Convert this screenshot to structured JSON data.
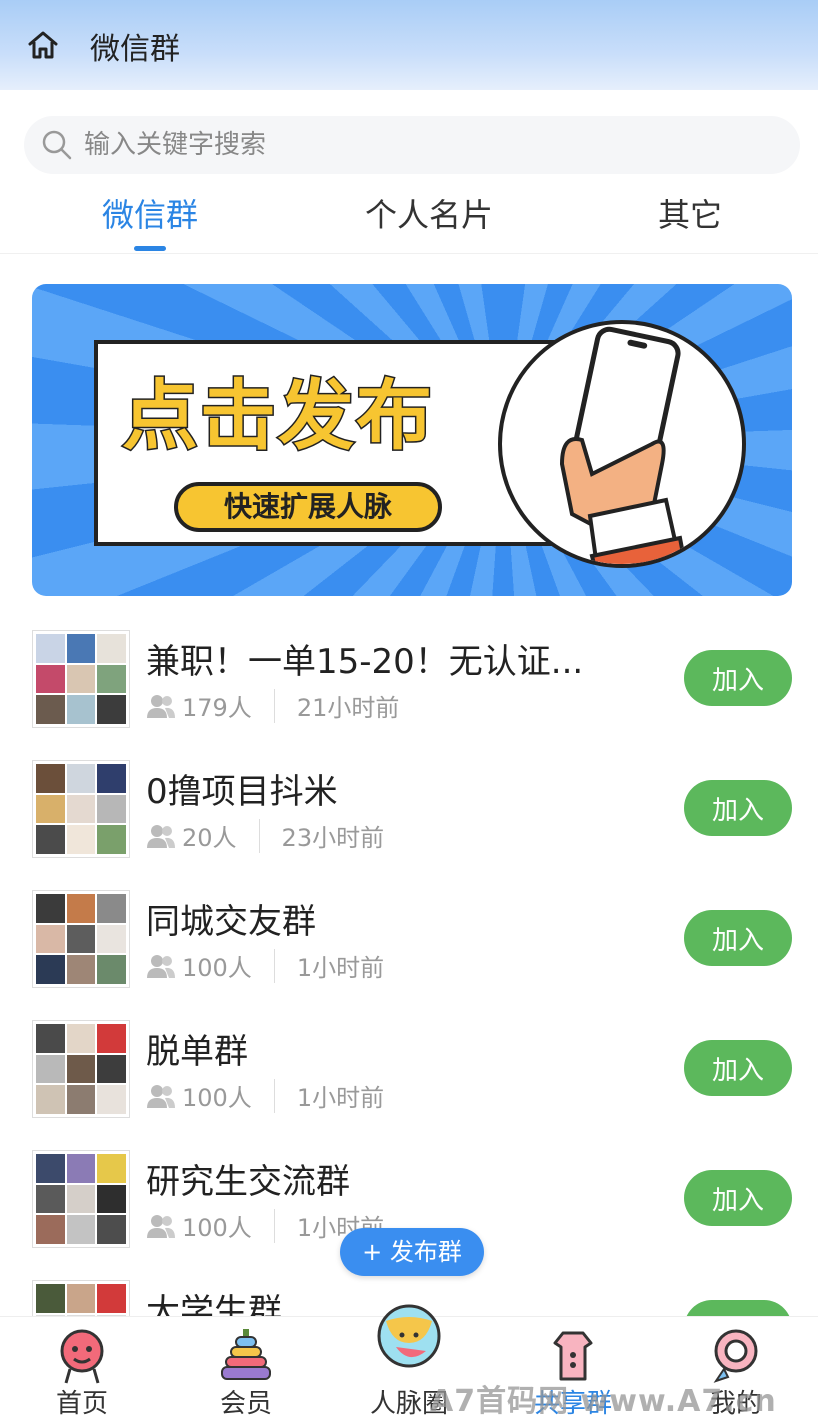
{
  "header": {
    "title": "微信群"
  },
  "search": {
    "placeholder": "输入关键字搜索"
  },
  "tabs": [
    {
      "label": "微信群",
      "active": true
    },
    {
      "label": "个人名片",
      "active": false
    },
    {
      "label": "其它",
      "active": false
    }
  ],
  "banner": {
    "headline": "点击发布",
    "subline": "快速扩展人脉"
  },
  "groups": [
    {
      "title": "兼职！一单15-20！无认证...",
      "members": "179人",
      "time": "21小时前",
      "join_label": "加入"
    },
    {
      "title": "0撸项目抖米",
      "members": "20人",
      "time": "23小时前",
      "join_label": "加入"
    },
    {
      "title": "同城交友群",
      "members": "100人",
      "time": "1小时前",
      "join_label": "加入"
    },
    {
      "title": "脱单群",
      "members": "100人",
      "time": "1小时前",
      "join_label": "加入"
    },
    {
      "title": "研究生交流群",
      "members": "100人",
      "time": "1小时前",
      "join_label": "加入"
    },
    {
      "title": "大学生群",
      "members": "",
      "time": "",
      "join_label": "加入"
    }
  ],
  "publish_button": "+ 发布群",
  "tabbar": [
    {
      "label": "首页",
      "icon": "home-icon"
    },
    {
      "label": "会员",
      "icon": "vip-icon"
    },
    {
      "label": "人脉圈",
      "icon": "network-icon"
    },
    {
      "label": "共享群",
      "icon": "share-group-icon",
      "active": true
    },
    {
      "label": "我的",
      "icon": "profile-icon"
    }
  ],
  "watermark": "A7首码网 www.A7.cn",
  "colors": {
    "accent": "#2b85e4",
    "join": "#5cb85c",
    "banner": "#3a8ef0",
    "highlight": "#f7c531"
  }
}
